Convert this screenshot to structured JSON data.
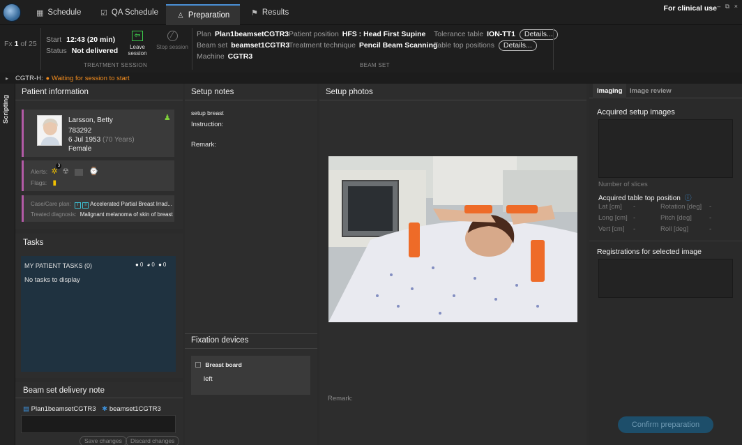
{
  "menubar": {
    "tabs": [
      {
        "label": "Schedule",
        "icon": "calendar-icon"
      },
      {
        "label": "QA Schedule",
        "icon": "qa-calendar-icon"
      },
      {
        "label": "Preparation",
        "icon": "person-stand-icon"
      },
      {
        "label": "Results",
        "icon": "results-flag-icon"
      }
    ],
    "active_tab": "Preparation",
    "clinical_use": "For clinical use"
  },
  "session": {
    "fx_prefix": "Fx",
    "fx_current": "1",
    "fx_of": "of 25",
    "start_label": "Start",
    "start_value": "12:43 (20 min)",
    "status_label": "Status",
    "status_value": "Not delivered",
    "leave_session": "Leave session",
    "stop_session": "Stop session",
    "treatment_session_caption": "TREATMENT SESSION"
  },
  "beam_set": {
    "plan_label": "Plan",
    "plan_value": "Plan1beamsetCGTR3",
    "beam_set_label": "Beam set",
    "beam_set_value": "beamset1CGTR3",
    "machine_label": "Machine",
    "machine_value": "CGTR3",
    "patient_position_label": "Patient position",
    "patient_position_value": "HFS : Head First Supine",
    "technique_label": "Treatment technique",
    "technique_value": "Pencil Beam Scanning",
    "tolerance_label": "Tolerance table",
    "tolerance_value": "ION-TT1",
    "table_top_label": "Table top positions",
    "details_label": "Details...",
    "caption": "BEAM SET"
  },
  "statusbar": {
    "machine": "CGTR-H:",
    "message": "Waiting for session to start",
    "color": "#f28c1e"
  },
  "scripting_label": "Scripting",
  "patient": {
    "header": "Patient information",
    "name": "Larsson, Betty",
    "id": "783292",
    "dob": "6 Jul 1953",
    "age": "(70 Years)",
    "sex": "Female",
    "alerts_label": "Alerts:",
    "alerts_badge": "3",
    "flags_label": "Flags:",
    "case_label": "Case/Care plan:",
    "case_value": "Accelerated Partial Breast Irrad...",
    "diagnosis_label": "Treated diagnosis:",
    "diagnosis_value": "Malignant melanoma of skin of breast"
  },
  "tasks": {
    "header": "Tasks",
    "my_tasks": "MY PATIENT TASKS (0)",
    "counts": [
      "0",
      "0",
      "0"
    ],
    "empty": "No tasks to display"
  },
  "delivery_note": {
    "header": "Beam set delivery note",
    "plan": "Plan1beamsetCGTR3",
    "beam_set": "beamset1CGTR3",
    "save": "Save changes",
    "discard": "Discard changes"
  },
  "setup_notes": {
    "header": "Setup notes",
    "note": "setup breast",
    "instruction_label": "Instruction:",
    "remark_label": "Remark:"
  },
  "fixation": {
    "header": "Fixation devices",
    "device": "Breast board",
    "value": "left"
  },
  "setup_photos": {
    "header": "Setup photos",
    "remark_label": "Remark:"
  },
  "imaging": {
    "tabs": [
      "Imaging",
      "Image review"
    ],
    "acquired_header": "Acquired setup images",
    "slices_label": "Number of slices",
    "table_top_header": "Acquired table top position",
    "lat_label": "Lat [cm]",
    "long_label": "Long [cm]",
    "vert_label": "Vert [cm]",
    "rotation_label": "Rotation [deg]",
    "pitch_label": "Pitch [deg]",
    "roll_label": "Roll [deg]",
    "dash": "-",
    "registrations_header": "Registrations for selected image",
    "confirm": "Confirm preparation"
  }
}
